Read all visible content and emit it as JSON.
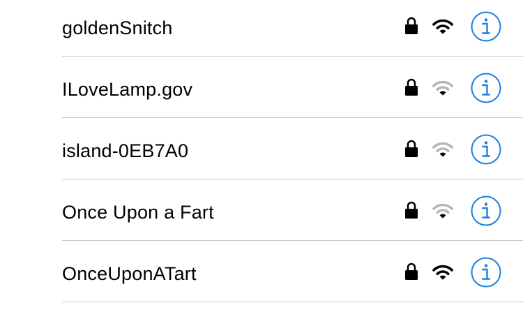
{
  "networks": [
    {
      "name": "goldenSnitch",
      "secured": true,
      "signal_bars_full": 3,
      "signal_bars_total": 3,
      "info_icon": "info-icon"
    },
    {
      "name": "ILoveLamp.gov",
      "secured": true,
      "signal_bars_full": 1,
      "signal_bars_total": 3,
      "info_icon": "info-icon"
    },
    {
      "name": "island-0EB7A0",
      "secured": true,
      "signal_bars_full": 1,
      "signal_bars_total": 3,
      "info_icon": "info-icon"
    },
    {
      "name": "Once Upon a Fart",
      "secured": true,
      "signal_bars_full": 1,
      "signal_bars_total": 3,
      "info_icon": "info-icon"
    },
    {
      "name": "OnceUponATart",
      "secured": true,
      "signal_bars_full": 3,
      "signal_bars_total": 3,
      "info_icon": "info-icon"
    }
  ],
  "colors": {
    "accent": "#1a7fe0",
    "signal_active": "#000000",
    "signal_inactive": "#b5b5b5",
    "divider": "#c8c7cc",
    "text": "#000000"
  }
}
